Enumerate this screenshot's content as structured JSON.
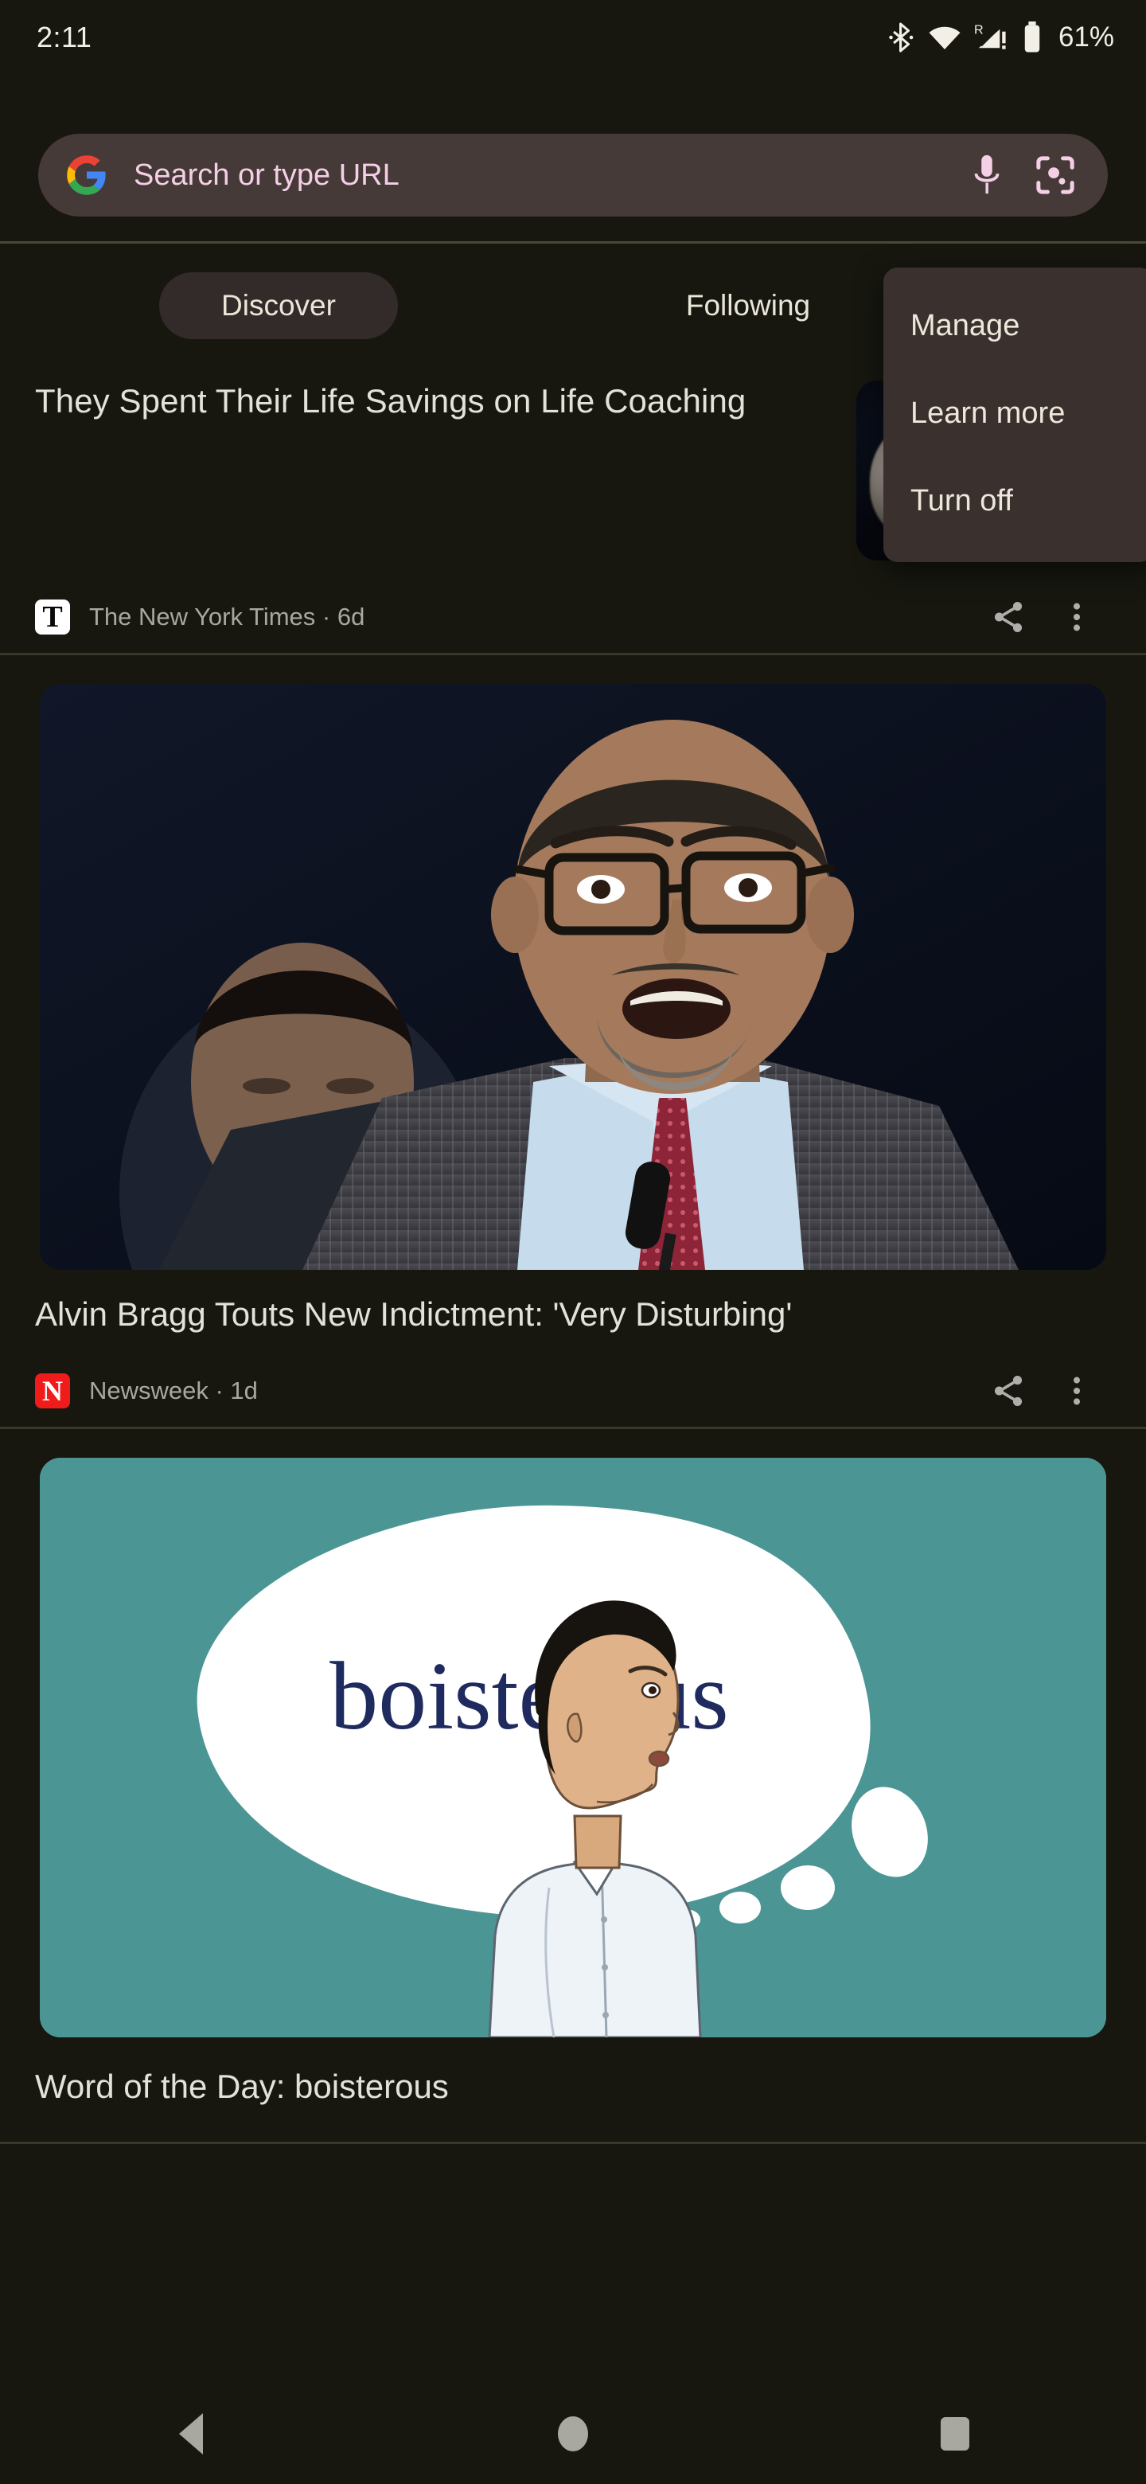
{
  "status_bar": {
    "time": "2:11",
    "battery_percent": "61%",
    "icons": [
      "bluetooth-icon",
      "wifi-icon",
      "cellular-roaming-no-signal-icon",
      "battery-icon"
    ]
  },
  "omnibox": {
    "placeholder": "Search or type URL",
    "logo": "google-g-logo",
    "mic_icon": "microphone-icon",
    "lens_icon": "google-lens-camera-icon"
  },
  "tabs": [
    {
      "label": "Discover",
      "selected": true
    },
    {
      "label": "Following",
      "selected": false
    }
  ],
  "menu": {
    "items": [
      {
        "label": "Manage"
      },
      {
        "label": "Learn more"
      },
      {
        "label": "Turn off"
      }
    ]
  },
  "feed": {
    "cards": [
      {
        "type": "compact",
        "title": "They Spent Their Life Savings on Life Coaching",
        "publisher": "The New York Times",
        "publisher_logo": "nyt-t-logo",
        "logo_glyph": "T",
        "age": "6d",
        "meta": "The New York Times · 6d",
        "share_icon": "share-icon",
        "overflow_icon": "more-vertical-icon",
        "thumbnail": "dark-portrait-thumbnail"
      },
      {
        "type": "large",
        "title": "Alvin Bragg Touts New Indictment: 'Very Disturbing'",
        "publisher": "Newsweek",
        "publisher_logo": "newsweek-n-logo",
        "logo_glyph": "N",
        "age": "1d",
        "meta": "Newsweek · 1d",
        "share_icon": "share-icon",
        "overflow_icon": "more-vertical-icon",
        "image": "alvin-bragg-press-conference-photo"
      },
      {
        "type": "large",
        "title": "Word of the Day: boisterous",
        "image": "word-of-the-day-illustration",
        "bubble_word": "boisterous"
      }
    ]
  },
  "nav_bar": {
    "back": "back-icon",
    "home": "home-icon",
    "recents": "recents-icon"
  },
  "colors": {
    "background": "#171710",
    "omnibox_bg": "#453a38",
    "omnibox_text": "#f4cfe6",
    "selected_tab_bg": "#332b29",
    "menu_bg": "#3a302e",
    "text_primary": "#e4e1d8",
    "text_secondary": "#a9a79e",
    "wotd_teal": "#4b9695",
    "wotd_word": "#1f2a5e",
    "newsweek_red": "#f01c1c"
  }
}
